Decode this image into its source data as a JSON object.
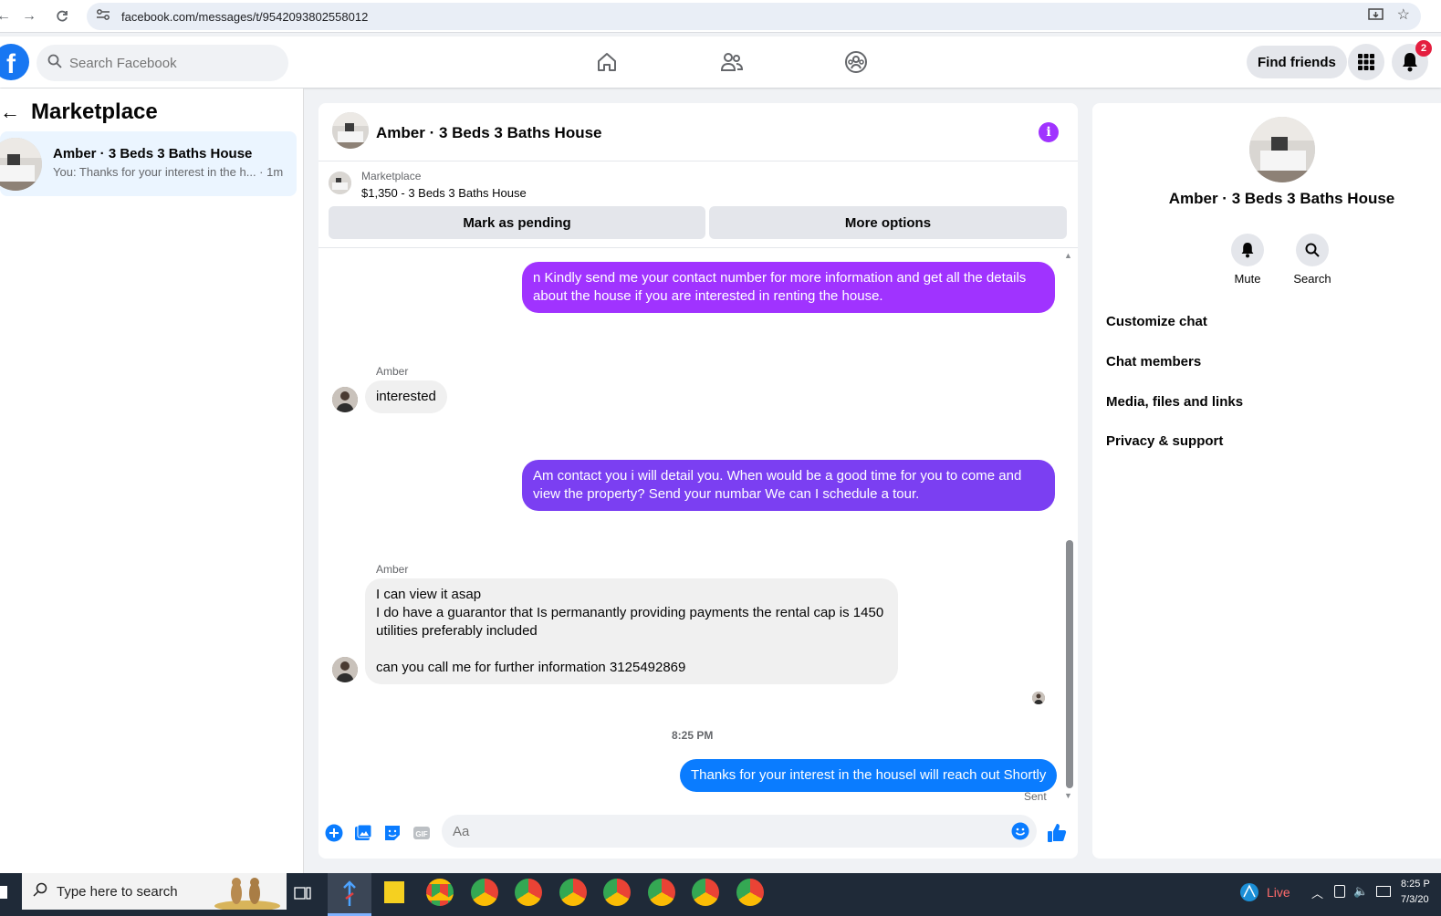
{
  "browser": {
    "url": "facebook.com/messages/t/9542093802558012"
  },
  "fb_nav": {
    "search_placeholder": "Search Facebook",
    "find_friends": "Find friends",
    "notification_count": "2"
  },
  "left": {
    "title": "Marketplace",
    "conversation": {
      "name": "Amber · 3 Beds 3 Baths House",
      "preview": "You: Thanks for your interest in the h... · 1m"
    }
  },
  "chat": {
    "title": "Amber · 3 Beds 3 Baths House",
    "marketplace_label": "Marketplace",
    "listing": "$1,350 - 3 Beds 3 Baths House",
    "mark_pending": "Mark as pending",
    "more_options": "More options",
    "messages": [
      {
        "from": "me",
        "text": "n Kindly send me your contact number for more information and get all the details about the house if you are interested in renting the house."
      },
      {
        "from": "Amber",
        "sender": "Amber",
        "text": "interested"
      },
      {
        "from": "me",
        "text": "Am contact you i will detail you.  When would be a good time for you to come and view the property? Send your numbar We can I schedule a tour."
      },
      {
        "from": "Amber",
        "sender": "Amber",
        "lines": [
          "I can view it asap",
          "I do have a guarantor that Is permanantly providing payments the rental cap is 1450",
          "utilities preferably included",
          "",
          "can you call me for further information  3125492869"
        ]
      },
      {
        "from": "me",
        "text": "Thanks for your interest in the housel will reach out Shortly"
      }
    ],
    "timestamp": "8:25 PM",
    "sent_label": "Sent",
    "composer_placeholder": "Aa",
    "colors": {
      "bubble_purple": "#a033ff",
      "bubble_violet": "#7b3ff2",
      "bubble_blue": "#0a7cff"
    }
  },
  "right": {
    "name": "Amber · 3 Beds 3 Baths House",
    "mute": "Mute",
    "search": "Search",
    "items": [
      "Customize chat",
      "Chat members",
      "Media, files and links",
      "Privacy & support"
    ]
  },
  "taskbar": {
    "search_placeholder": "Type here to search",
    "live": "Live",
    "time": "8:25 P",
    "date": "7/3/20"
  }
}
